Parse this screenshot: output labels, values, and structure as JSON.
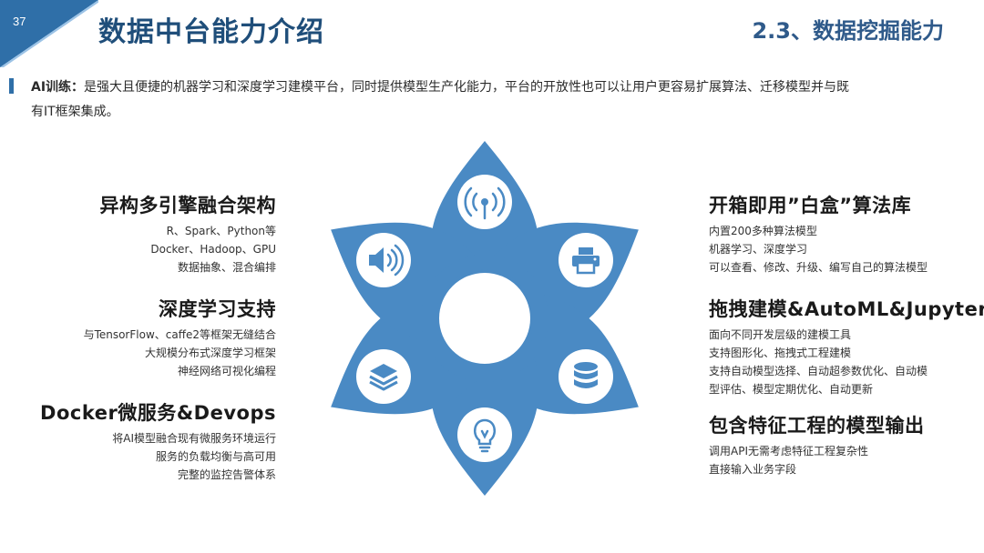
{
  "page_number": "37",
  "title": "数据中台能力介绍",
  "section": "2.3、数据挖掘能力",
  "intro": {
    "lead": "AI训练：",
    "line1": "是强大且便捷的机器学习和深度学习建模平台，同时提供模型生产化能力，平台的开放性也可以让用户更容易扩展算法、迁移模型并与既",
    "line2": "有IT框架集成。"
  },
  "left_blocks": [
    {
      "title": "异构多引擎融合架构",
      "lines": [
        "R、Spark、Python等",
        "Docker、Hadoop、GPU",
        "数据抽象、混合编排"
      ]
    },
    {
      "title": "深度学习支持",
      "lines": [
        "与TensorFlow、caffe2等框架无缝结合",
        "大规模分布式深度学习框架",
        "神经网络可视化编程"
      ]
    },
    {
      "title": "Docker微服务&Devops",
      "lines": [
        "将AI模型融合现有微服务环境运行",
        "服务的负载均衡与高可用",
        "完整的监控告警体系"
      ]
    }
  ],
  "right_blocks": [
    {
      "title": "开箱即用”白盒”算法库",
      "lines": [
        "内置200多种算法模型",
        "机器学习、深度学习",
        "可以查看、修改、升级、编写自己的算法模型"
      ]
    },
    {
      "title": "拖拽建模&AutoML&Jupyter",
      "lines": [
        "面向不同开发层级的建模工具",
        "支持图形化、拖拽式工程建模",
        "支持自动模型选择、自动超参数优化、自动模",
        "型评估、模型定期优化、自动更新"
      ]
    },
    {
      "title": "包含特征工程的模型输出",
      "lines": [
        "调用API无需考虑特征工程复杂性",
        "直接输入业务字段"
      ]
    }
  ],
  "colors": {
    "accent": "#4a8ac4",
    "title": "#1f4e7a",
    "corner": "#2f6fa8"
  },
  "icons": [
    "broadcast-tower-icon",
    "printer-icon",
    "database-icon",
    "lightbulb-icon",
    "layers-icon",
    "speaker-icon"
  ]
}
